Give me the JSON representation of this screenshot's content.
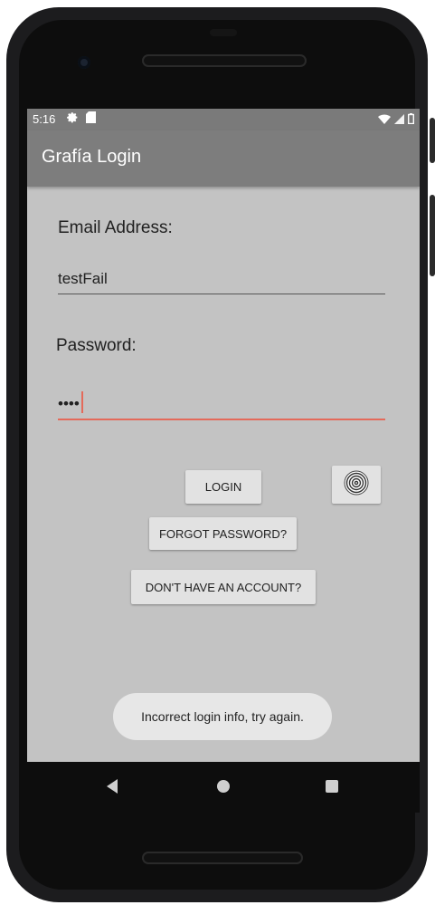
{
  "status_bar": {
    "time": "5:16",
    "settings_icon": "gear-icon",
    "sd_icon": "sd-card-icon",
    "wifi_icon": "wifi-icon",
    "signal_icon": "signal-icon",
    "battery_icon": "battery-icon"
  },
  "app_bar": {
    "title": "Grafía Login"
  },
  "form": {
    "email_label": "Email Address:",
    "email_value": "testFail",
    "password_label": "Password:",
    "password_value": "••••"
  },
  "buttons": {
    "login": "LOGIN",
    "forgot": "FORGOT PASSWORD?",
    "no_account": "DON'T HAVE AN ACCOUNT?",
    "fingerprint_icon": "fingerprint-icon"
  },
  "toast": {
    "message": "Incorrect login info, try again."
  },
  "nav_bar": {
    "back_icon": "back-icon",
    "home_icon": "home-icon",
    "recents_icon": "recents-icon"
  },
  "colors": {
    "accent": "#e46a5a",
    "app_bar": "#7d7d7d",
    "background": "#c3c3c3"
  }
}
